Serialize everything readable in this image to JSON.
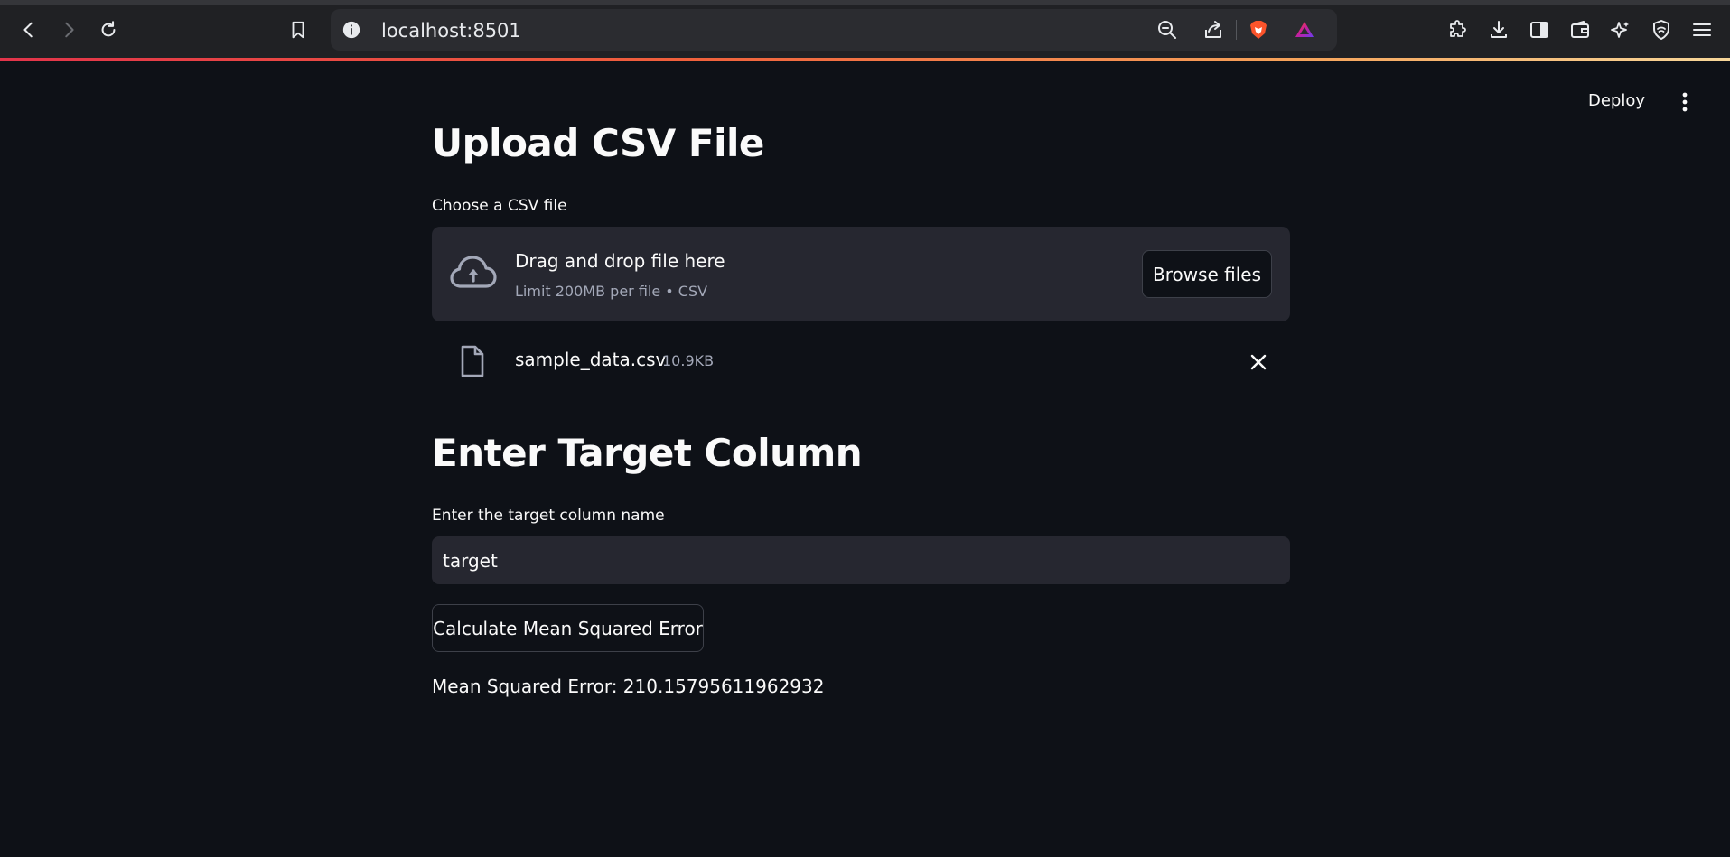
{
  "browser": {
    "url": "localhost:8501",
    "icons": [
      "back-icon",
      "forward-icon",
      "reload-icon",
      "bookmark-icon",
      "info-icon",
      "zoom-out-icon",
      "share-icon",
      "brave-shield-icon",
      "brave-rewards-icon",
      "extensions-icon",
      "download-icon",
      "sidebar-icon",
      "wallet-icon",
      "leo-ai-icon",
      "vpn-icon",
      "menu-icon"
    ]
  },
  "app": {
    "deploy_label": "Deploy"
  },
  "upload": {
    "title": "Upload CSV File",
    "label": "Choose a CSV file",
    "dropzone_title": "Drag and drop file here",
    "dropzone_subtitle": "Limit 200MB per file • CSV",
    "browse_label": "Browse files",
    "file": {
      "name": "sample_data.csv",
      "size": "10.9KB"
    }
  },
  "target": {
    "title": "Enter Target Column",
    "label": "Enter the target column name",
    "value": "target",
    "button_label": "Calculate Mean Squared Error",
    "result": "Mean Squared Error: 210.15795611962932"
  },
  "colors": {
    "background": "#0e1117",
    "surface": "#262730",
    "accent_gradient_start": "#e2344a",
    "accent_gradient_end": "#f7d79a"
  }
}
